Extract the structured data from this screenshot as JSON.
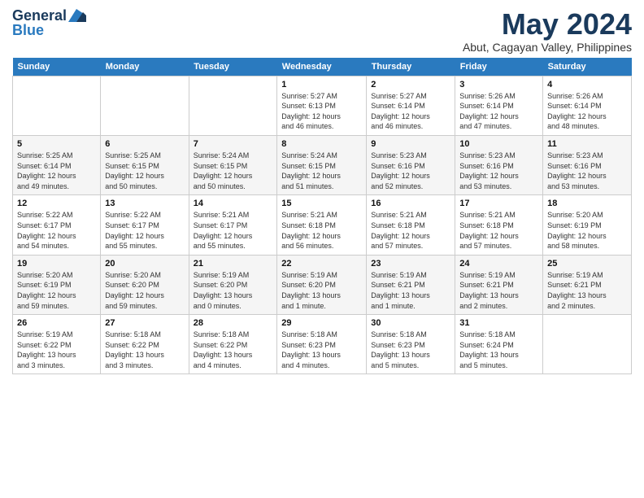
{
  "header": {
    "logo_line1": "General",
    "logo_line2": "Blue",
    "month_title": "May 2024",
    "location": "Abut, Cagayan Valley, Philippines"
  },
  "days_of_week": [
    "Sunday",
    "Monday",
    "Tuesday",
    "Wednesday",
    "Thursday",
    "Friday",
    "Saturday"
  ],
  "weeks": [
    [
      {
        "day": "",
        "info": ""
      },
      {
        "day": "",
        "info": ""
      },
      {
        "day": "",
        "info": ""
      },
      {
        "day": "1",
        "info": "Sunrise: 5:27 AM\nSunset: 6:13 PM\nDaylight: 12 hours\nand 46 minutes."
      },
      {
        "day": "2",
        "info": "Sunrise: 5:27 AM\nSunset: 6:14 PM\nDaylight: 12 hours\nand 46 minutes."
      },
      {
        "day": "3",
        "info": "Sunrise: 5:26 AM\nSunset: 6:14 PM\nDaylight: 12 hours\nand 47 minutes."
      },
      {
        "day": "4",
        "info": "Sunrise: 5:26 AM\nSunset: 6:14 PM\nDaylight: 12 hours\nand 48 minutes."
      }
    ],
    [
      {
        "day": "5",
        "info": "Sunrise: 5:25 AM\nSunset: 6:14 PM\nDaylight: 12 hours\nand 49 minutes."
      },
      {
        "day": "6",
        "info": "Sunrise: 5:25 AM\nSunset: 6:15 PM\nDaylight: 12 hours\nand 50 minutes."
      },
      {
        "day": "7",
        "info": "Sunrise: 5:24 AM\nSunset: 6:15 PM\nDaylight: 12 hours\nand 50 minutes."
      },
      {
        "day": "8",
        "info": "Sunrise: 5:24 AM\nSunset: 6:15 PM\nDaylight: 12 hours\nand 51 minutes."
      },
      {
        "day": "9",
        "info": "Sunrise: 5:23 AM\nSunset: 6:16 PM\nDaylight: 12 hours\nand 52 minutes."
      },
      {
        "day": "10",
        "info": "Sunrise: 5:23 AM\nSunset: 6:16 PM\nDaylight: 12 hours\nand 53 minutes."
      },
      {
        "day": "11",
        "info": "Sunrise: 5:23 AM\nSunset: 6:16 PM\nDaylight: 12 hours\nand 53 minutes."
      }
    ],
    [
      {
        "day": "12",
        "info": "Sunrise: 5:22 AM\nSunset: 6:17 PM\nDaylight: 12 hours\nand 54 minutes."
      },
      {
        "day": "13",
        "info": "Sunrise: 5:22 AM\nSunset: 6:17 PM\nDaylight: 12 hours\nand 55 minutes."
      },
      {
        "day": "14",
        "info": "Sunrise: 5:21 AM\nSunset: 6:17 PM\nDaylight: 12 hours\nand 55 minutes."
      },
      {
        "day": "15",
        "info": "Sunrise: 5:21 AM\nSunset: 6:18 PM\nDaylight: 12 hours\nand 56 minutes."
      },
      {
        "day": "16",
        "info": "Sunrise: 5:21 AM\nSunset: 6:18 PM\nDaylight: 12 hours\nand 57 minutes."
      },
      {
        "day": "17",
        "info": "Sunrise: 5:21 AM\nSunset: 6:18 PM\nDaylight: 12 hours\nand 57 minutes."
      },
      {
        "day": "18",
        "info": "Sunrise: 5:20 AM\nSunset: 6:19 PM\nDaylight: 12 hours\nand 58 minutes."
      }
    ],
    [
      {
        "day": "19",
        "info": "Sunrise: 5:20 AM\nSunset: 6:19 PM\nDaylight: 12 hours\nand 59 minutes."
      },
      {
        "day": "20",
        "info": "Sunrise: 5:20 AM\nSunset: 6:20 PM\nDaylight: 12 hours\nand 59 minutes."
      },
      {
        "day": "21",
        "info": "Sunrise: 5:19 AM\nSunset: 6:20 PM\nDaylight: 13 hours\nand 0 minutes."
      },
      {
        "day": "22",
        "info": "Sunrise: 5:19 AM\nSunset: 6:20 PM\nDaylight: 13 hours\nand 1 minute."
      },
      {
        "day": "23",
        "info": "Sunrise: 5:19 AM\nSunset: 6:21 PM\nDaylight: 13 hours\nand 1 minute."
      },
      {
        "day": "24",
        "info": "Sunrise: 5:19 AM\nSunset: 6:21 PM\nDaylight: 13 hours\nand 2 minutes."
      },
      {
        "day": "25",
        "info": "Sunrise: 5:19 AM\nSunset: 6:21 PM\nDaylight: 13 hours\nand 2 minutes."
      }
    ],
    [
      {
        "day": "26",
        "info": "Sunrise: 5:19 AM\nSunset: 6:22 PM\nDaylight: 13 hours\nand 3 minutes."
      },
      {
        "day": "27",
        "info": "Sunrise: 5:18 AM\nSunset: 6:22 PM\nDaylight: 13 hours\nand 3 minutes."
      },
      {
        "day": "28",
        "info": "Sunrise: 5:18 AM\nSunset: 6:22 PM\nDaylight: 13 hours\nand 4 minutes."
      },
      {
        "day": "29",
        "info": "Sunrise: 5:18 AM\nSunset: 6:23 PM\nDaylight: 13 hours\nand 4 minutes."
      },
      {
        "day": "30",
        "info": "Sunrise: 5:18 AM\nSunset: 6:23 PM\nDaylight: 13 hours\nand 5 minutes."
      },
      {
        "day": "31",
        "info": "Sunrise: 5:18 AM\nSunset: 6:24 PM\nDaylight: 13 hours\nand 5 minutes."
      },
      {
        "day": "",
        "info": ""
      }
    ]
  ]
}
